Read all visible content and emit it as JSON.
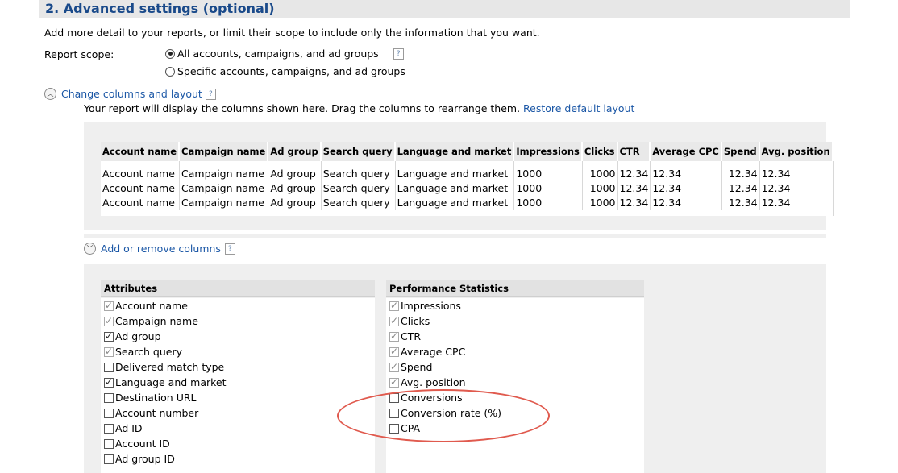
{
  "section": {
    "title": "2. Advanced settings (optional)"
  },
  "intro": "Add more detail to your reports, or limit their scope to include only the information that you want.",
  "scope": {
    "label": "Report scope:",
    "options": [
      {
        "label": "All accounts, campaigns, and ad groups",
        "selected": true
      },
      {
        "label": "Specific accounts, campaigns, and ad groups",
        "selected": false
      }
    ],
    "help": "?"
  },
  "columns_section": {
    "toggle_label": "Change columns and layout",
    "help": "?",
    "description": "Your report will display the columns shown here. Drag the columns to rearrange them.",
    "restore_link": "Restore default layout",
    "preview": {
      "headers": [
        "Account name",
        "Campaign name",
        "Ad group",
        "Search query",
        "Language and market",
        "Impressions",
        "Clicks",
        "CTR",
        "Average CPC",
        "Spend",
        "Avg. position"
      ],
      "rows": [
        [
          "Account name",
          "Campaign name",
          "Ad group",
          "Search query",
          "Language and market",
          "1000",
          "1000",
          "12.34",
          "12.34",
          "12.34",
          "12.34"
        ],
        [
          "Account name",
          "Campaign name",
          "Ad group",
          "Search query",
          "Language and market",
          "1000",
          "1000",
          "12.34",
          "12.34",
          "12.34",
          "12.34"
        ],
        [
          "Account name",
          "Campaign name",
          "Ad group",
          "Search query",
          "Language and market",
          "1000",
          "1000",
          "12.34",
          "12.34",
          "12.34",
          "12.34"
        ]
      ]
    }
  },
  "add_remove": {
    "toggle_label": "Add or remove columns",
    "help": "?",
    "attributes": {
      "header": "Attributes",
      "items": [
        {
          "label": "Account name",
          "checked": true,
          "disabled": true
        },
        {
          "label": "Campaign name",
          "checked": true,
          "disabled": true
        },
        {
          "label": "Ad group",
          "checked": true,
          "disabled": false
        },
        {
          "label": "Search query",
          "checked": true,
          "disabled": true
        },
        {
          "label": "Delivered match type",
          "checked": false,
          "disabled": false
        },
        {
          "label": "Language and market",
          "checked": true,
          "disabled": false
        },
        {
          "label": "Destination URL",
          "checked": false,
          "disabled": false
        },
        {
          "label": "Account number",
          "checked": false,
          "disabled": false
        },
        {
          "label": "Ad ID",
          "checked": false,
          "disabled": false
        },
        {
          "label": "Account ID",
          "checked": false,
          "disabled": false
        },
        {
          "label": "Ad group ID",
          "checked": false,
          "disabled": false
        }
      ]
    },
    "performance": {
      "header": "Performance Statistics",
      "items": [
        {
          "label": "Impressions",
          "checked": true,
          "disabled": true
        },
        {
          "label": "Clicks",
          "checked": true,
          "disabled": true
        },
        {
          "label": "CTR",
          "checked": true,
          "disabled": true
        },
        {
          "label": "Average CPC",
          "checked": true,
          "disabled": true
        },
        {
          "label": "Spend",
          "checked": true,
          "disabled": true
        },
        {
          "label": "Avg. position",
          "checked": true,
          "disabled": true
        },
        {
          "label": "Conversions",
          "checked": false,
          "disabled": false
        },
        {
          "label": "Conversion rate (%)",
          "checked": false,
          "disabled": false
        },
        {
          "label": "CPA",
          "checked": false,
          "disabled": false
        }
      ]
    }
  },
  "colors": {
    "link": "#1b57a6",
    "title": "#1a4a8a",
    "annotation": "#e05a4e"
  }
}
